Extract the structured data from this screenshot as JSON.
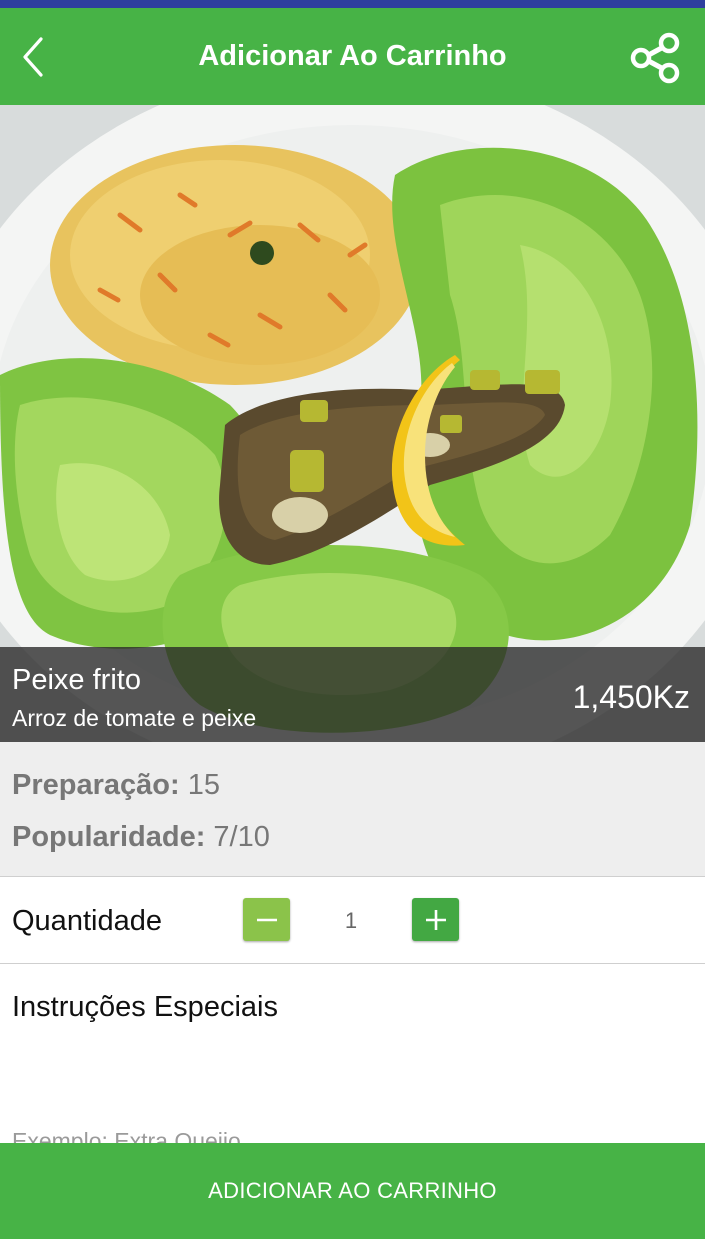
{
  "header": {
    "title": "Adicionar Ao Carrinho",
    "back_icon": "chevron-left-icon",
    "share_icon": "share-icon"
  },
  "dish": {
    "name": "Peixe frito",
    "description": "Arroz de tomate e peixe",
    "price": "1,450Kz"
  },
  "details": {
    "preparation_label": "Preparação:",
    "preparation_value": "15",
    "popularity_label": "Popularidade:",
    "popularity_value": "7/10"
  },
  "quantity": {
    "label": "Quantidade",
    "value": "1",
    "minus_icon": "minus-icon",
    "plus_icon": "plus-icon"
  },
  "instructions": {
    "label": "Instruções Especiais",
    "placeholder": "Exemplo: Extra Queijo"
  },
  "footer": {
    "add_button": "ADICIONAR AO CARRINHO"
  },
  "colors": {
    "primary": "#47b346",
    "status_bar": "#2e3f9e",
    "minus_button": "#8bc34a",
    "plus_button": "#43a843"
  }
}
